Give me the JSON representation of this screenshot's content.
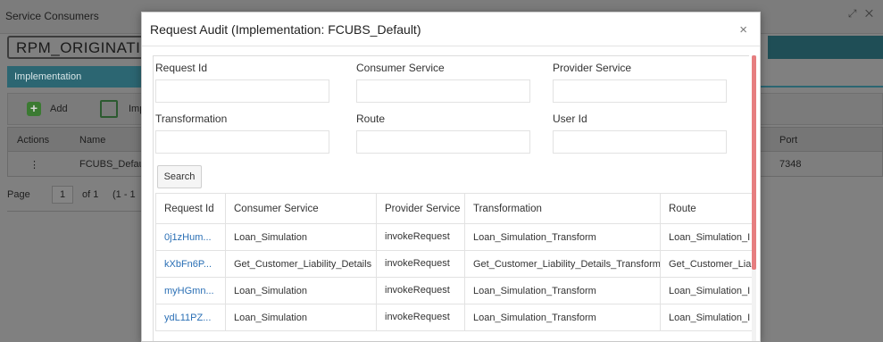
{
  "background": {
    "window_title": "Service Consumers",
    "consumer_name": "RPM_ORIGINATIO",
    "tab_label": "Implementation",
    "add_label": "Add",
    "import_label": "Imp",
    "grid": {
      "columns": {
        "actions": "Actions",
        "name": "Name",
        "port": "Port"
      },
      "row": {
        "actions": "⋮",
        "name": "FCUBS_Default",
        "port": "7348"
      }
    },
    "pager": {
      "page_label": "Page",
      "page_value": "1",
      "of_label": "of 1",
      "range": "(1 - 1"
    }
  },
  "modal": {
    "title": "Request Audit (Implementation: FCUBS_Default)",
    "close": "×",
    "fields": {
      "request_id": {
        "label": "Request Id",
        "value": ""
      },
      "consumer_service": {
        "label": "Consumer Service",
        "value": ""
      },
      "provider_service": {
        "label": "Provider Service",
        "value": ""
      },
      "transformation": {
        "label": "Transformation",
        "value": ""
      },
      "route": {
        "label": "Route",
        "value": ""
      },
      "user_id": {
        "label": "User Id",
        "value": ""
      }
    },
    "search_label": "Search",
    "table": {
      "headers": {
        "request_id": "Request Id",
        "consumer_service": "Consumer Service",
        "provider_service": "Provider Service",
        "transformation": "Transformation",
        "route": "Route"
      },
      "rows": [
        {
          "request_id": "0j1zHum...",
          "consumer_service": "Loan_Simulation",
          "provider_service": "invokeRequest",
          "transformation": "Loan_Simulation_Transform",
          "route": "Loan_Simulation_I"
        },
        {
          "request_id": "kXbFn6P...",
          "consumer_service": "Get_Customer_Liability_Details",
          "provider_service": "invokeRequest",
          "transformation": "Get_Customer_Liability_Details_Transform",
          "route": "Get_Customer_Lia"
        },
        {
          "request_id": "myHGmn...",
          "consumer_service": "Loan_Simulation",
          "provider_service": "invokeRequest",
          "transformation": "Loan_Simulation_Transform",
          "route": "Loan_Simulation_I"
        },
        {
          "request_id": "ydL11PZ...",
          "consumer_service": "Loan_Simulation",
          "provider_service": "invokeRequest",
          "transformation": "Loan_Simulation_Transform",
          "route": "Loan_Simulation_I"
        }
      ]
    }
  },
  "colors": {
    "overlay": "#808080",
    "tab_accent": "#2c6672",
    "link": "#2a6fb5",
    "scrollbar_thumb": "#e67e80"
  }
}
